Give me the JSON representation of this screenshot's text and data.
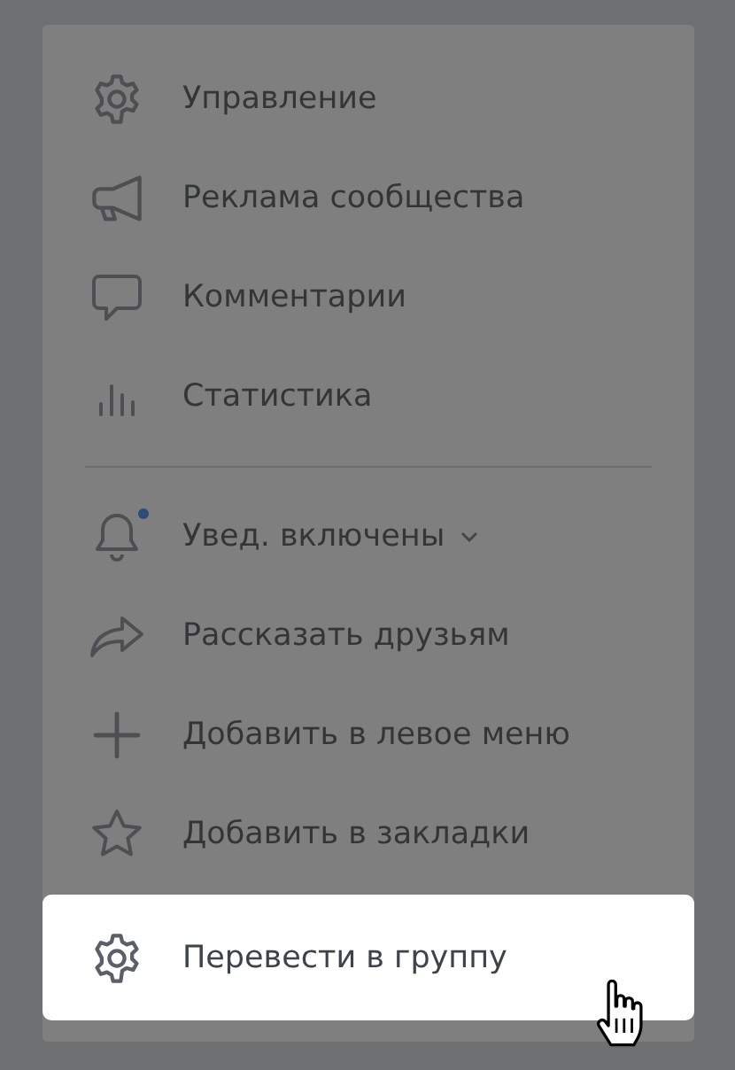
{
  "menu": {
    "sections": [
      {
        "items": [
          {
            "label": "Управление",
            "selected": false,
            "dot": false,
            "dropdown": false
          },
          {
            "label": "Реклама сообщества",
            "selected": false,
            "dot": false,
            "dropdown": false
          },
          {
            "label": "Комментарии",
            "selected": false,
            "dot": false,
            "dropdown": false
          },
          {
            "label": "Статистика",
            "selected": false,
            "dot": false,
            "dropdown": false
          }
        ]
      },
      {
        "items": [
          {
            "label": "Увед. включены",
            "selected": false,
            "dot": true,
            "dropdown": true
          },
          {
            "label": "Рассказать друзьям",
            "selected": false,
            "dot": false,
            "dropdown": false
          },
          {
            "label": "Добавить в левое меню",
            "selected": false,
            "dot": false,
            "dropdown": false
          },
          {
            "label": "Добавить в закладки",
            "selected": false,
            "dot": false,
            "dropdown": false
          },
          {
            "label": "Перевести в группу",
            "selected": true,
            "dot": false,
            "dropdown": false
          }
        ]
      }
    ]
  }
}
